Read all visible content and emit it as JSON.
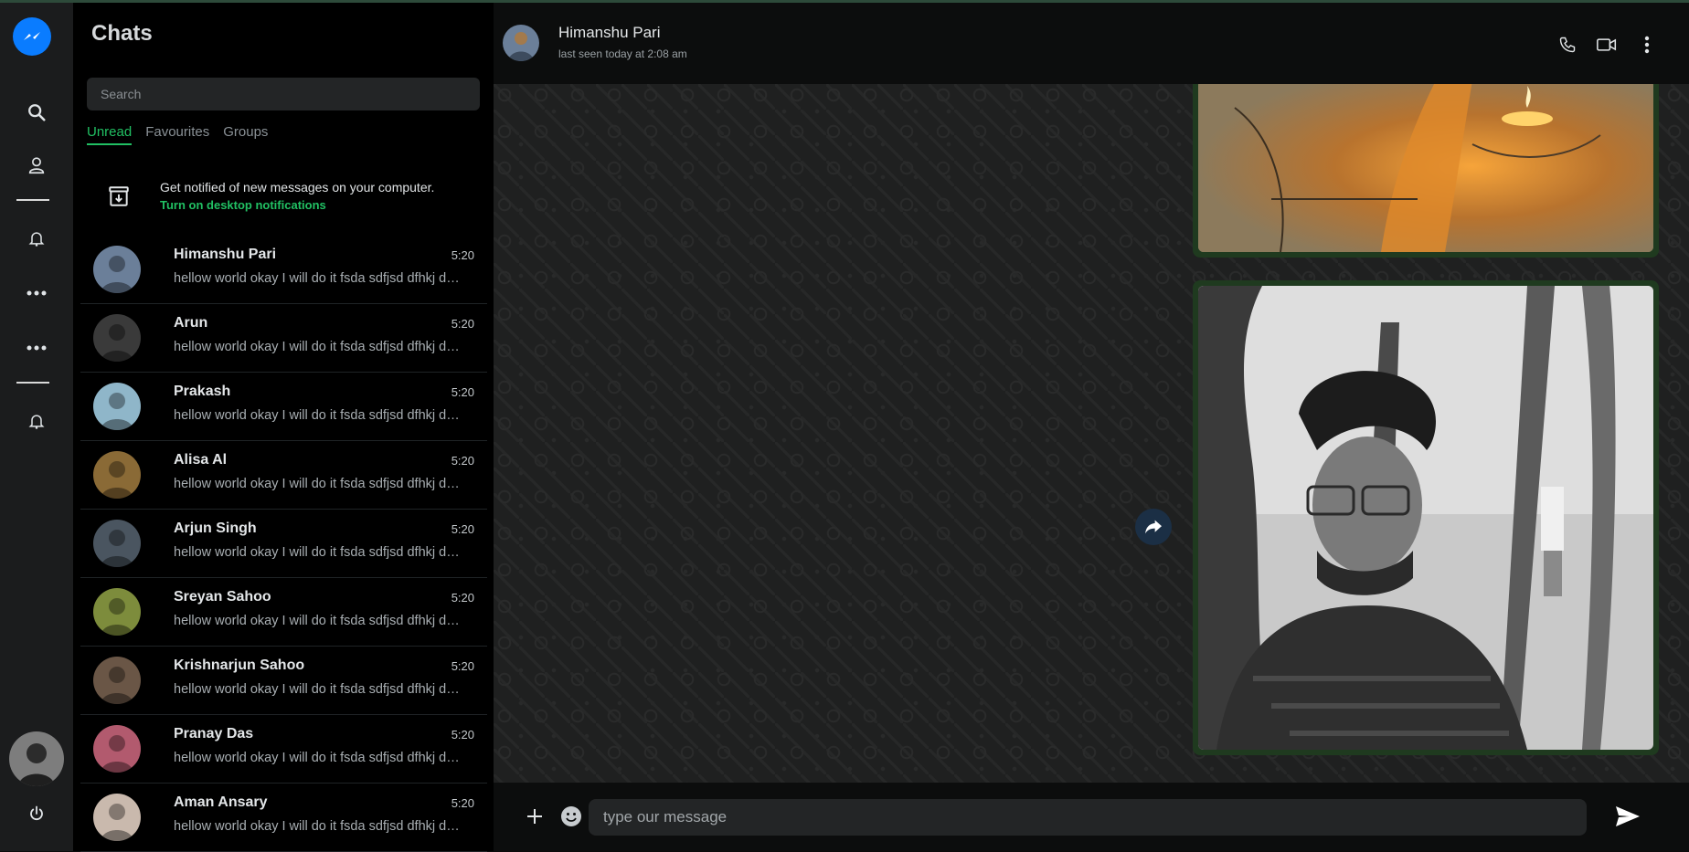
{
  "colors": {
    "accent": "#21c063",
    "brand": "#0a7cff",
    "bubble": "#1f3a1f"
  },
  "rail": {
    "items": [
      {
        "icon": "messenger-logo-icon"
      },
      {
        "icon": "search-icon"
      },
      {
        "icon": "user-icon"
      },
      {
        "icon": "bell-icon"
      },
      {
        "icon": "more-dots-icon"
      },
      {
        "icon": "more-dots-icon"
      },
      {
        "icon": "bell-icon"
      },
      {
        "icon": "power-icon"
      }
    ]
  },
  "panel": {
    "title": "Chats",
    "search_placeholder": "Search",
    "tabs": [
      "Unread",
      "Favourites",
      "Groups"
    ],
    "notification": {
      "text": "Get notified of new messages on your computer.",
      "link": "Turn on desktop notifications"
    }
  },
  "chats": [
    {
      "name": "Himanshu Pari",
      "time": "5:20",
      "message": "hellow world okay I will do it fsda sdfjsd dfhkj dd...",
      "avatar_color": "#6b7f99"
    },
    {
      "name": "Arun",
      "time": "5:20",
      "message": "hellow world okay I will do it fsda sdfjsd dfhkj dd...",
      "avatar_color": "#3a3a3a"
    },
    {
      "name": "Prakash",
      "time": "5:20",
      "message": "hellow world okay I will do it fsda sdfjsd dfhkj dd...",
      "avatar_color": "#8fb6c9"
    },
    {
      "name": "Alisa Al",
      "time": "5:20",
      "message": "hellow world okay I will do it fsda sdfjsd dfhkj dd...",
      "avatar_color": "#8a6a36"
    },
    {
      "name": "Arjun Singh",
      "time": "5:20",
      "message": "hellow world okay I will do it fsda sdfjsd dfhkj dd...",
      "avatar_color": "#4a5560"
    },
    {
      "name": "Sreyan Sahoo",
      "time": "5:20",
      "message": "hellow world okay I will do it fsda sdfjsd dfhkj dd...",
      "avatar_color": "#7d8c3c"
    },
    {
      "name": "Krishnarjun Sahoo",
      "time": "5:20",
      "message": "hellow world okay I will do it fsda sdfjsd dfhkj dd...",
      "avatar_color": "#6a5646"
    },
    {
      "name": "Pranay Das",
      "time": "5:20",
      "message": "hellow world okay I will do it fsda sdfjsd dfhkj dd...",
      "avatar_color": "#b25a6e"
    },
    {
      "name": "Aman Ansary",
      "time": "5:20",
      "message": "hellow world okay I will do it fsda sdfjsd dfhkj dd...",
      "avatar_color": "#c9b9ad"
    }
  ],
  "header": {
    "name": "Himanshu Pari",
    "status": "last seen today at 2:08 am"
  },
  "composer": {
    "placeholder": "type our message"
  }
}
